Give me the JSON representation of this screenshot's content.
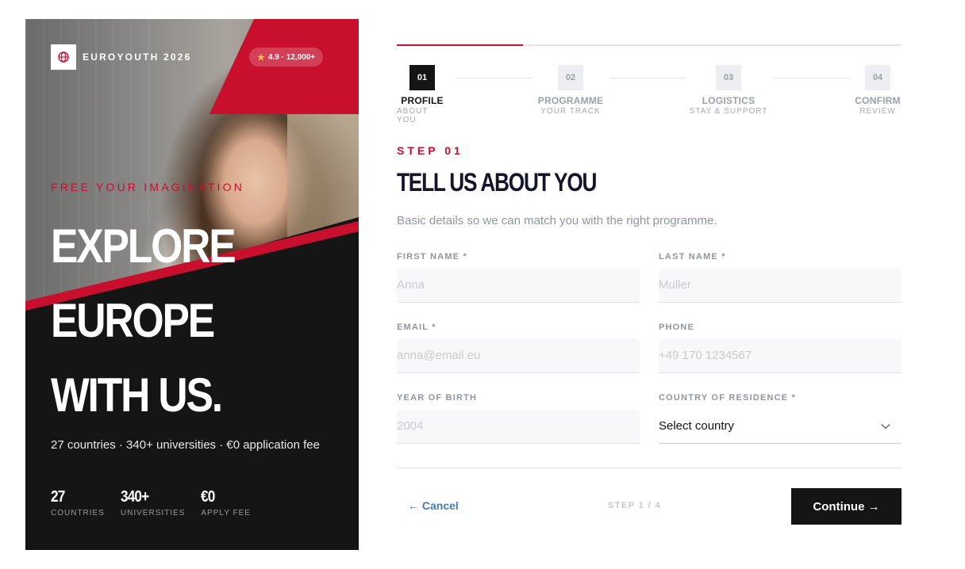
{
  "hero": {
    "brand": "EUROYOUTH 2026",
    "rating": "4.9 · 12,000+",
    "tagline": "FREE YOUR IMAGINATION",
    "headline": [
      "EXPLORE",
      "EUROPE",
      "WITH US."
    ],
    "subtitle": "27 countries · 340+ universities · €0 application fee",
    "stats": [
      {
        "value": "27",
        "label": "COUNTRIES"
      },
      {
        "value": "340+",
        "label": "UNIVERSITIES"
      },
      {
        "value": "€0",
        "label": "APPLY FEE"
      }
    ],
    "colors": {
      "accent": "#c8102e",
      "dark": "#151515"
    }
  },
  "progress": {
    "completed_fraction": 0.25
  },
  "steps": [
    {
      "number": "01",
      "title": "PROFILE",
      "subtitle": "ABOUT YOU",
      "active": true
    },
    {
      "number": "02",
      "title": "PROGRAMME",
      "subtitle": "YOUR TRACK",
      "active": false
    },
    {
      "number": "03",
      "title": "LOGISTICS",
      "subtitle": "STAY & SUPPORT",
      "active": false
    },
    {
      "number": "04",
      "title": "CONFIRM",
      "subtitle": "REVIEW",
      "active": false
    }
  ],
  "form": {
    "step_label": "STEP 01",
    "title": "TELL US ABOUT YOU",
    "description": "Basic details so we can match you with the right programme.",
    "fields": {
      "first_name": {
        "label": "FIRST NAME *",
        "placeholder": "Anna",
        "value": ""
      },
      "last_name": {
        "label": "LAST NAME *",
        "placeholder": "Muller",
        "value": ""
      },
      "email": {
        "label": "EMAIL *",
        "placeholder": "anna@email.eu",
        "value": ""
      },
      "phone": {
        "label": "PHONE",
        "placeholder": "+49 170 1234567",
        "value": ""
      },
      "year_of_birth": {
        "label": "YEAR OF BIRTH",
        "placeholder": "2004",
        "value": ""
      },
      "country": {
        "label": "COUNTRY OF RESIDENCE *",
        "selected": "Select country"
      }
    }
  },
  "footer": {
    "cancel_label": "← Cancel",
    "step_count": "STEP 1 / 4",
    "continue_label": "Continue →"
  },
  "icons": {
    "brand": "globe-icon",
    "rating": "star-icon",
    "select": "chevron-down-icon"
  }
}
